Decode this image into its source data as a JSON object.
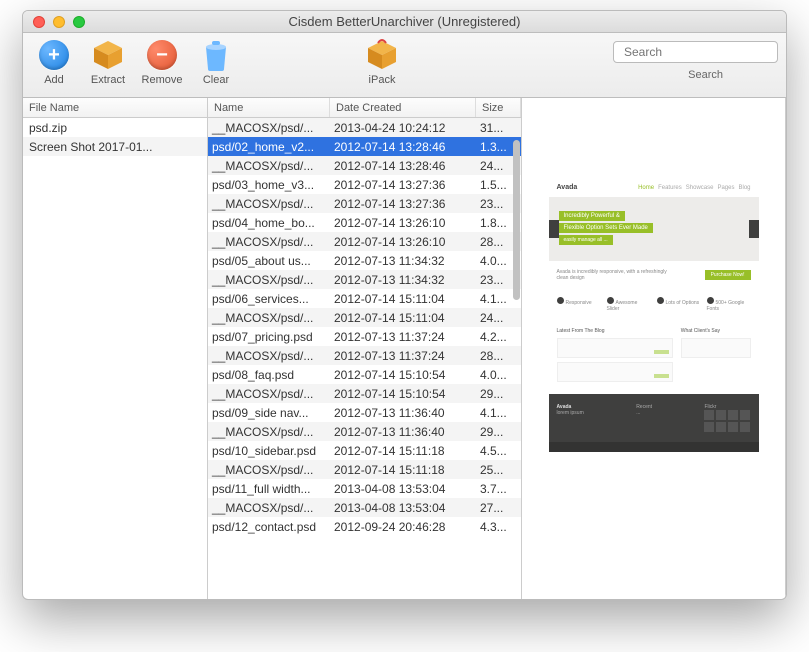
{
  "window": {
    "title": "Cisdem BetterUnarchiver (Unregistered)"
  },
  "toolbar": {
    "add": "Add",
    "extract": "Extract",
    "remove": "Remove",
    "clear": "Clear",
    "ipack": "iPack"
  },
  "search": {
    "placeholder": "Search",
    "label": "Search"
  },
  "files": {
    "header": "File Name",
    "items": [
      {
        "name": "psd.zip"
      },
      {
        "name": "Screen Shot 2017-01..."
      }
    ]
  },
  "entries": {
    "headers": {
      "name": "Name",
      "date": "Date Created",
      "size": "Size"
    },
    "rows": [
      {
        "name": "__MACOSX/psd/...",
        "date": "2013-04-24 10:24:12",
        "size": "31...",
        "selected": false
      },
      {
        "name": "psd/02_home_v2...",
        "date": "2012-07-14 13:28:46",
        "size": "1.3...",
        "selected": true
      },
      {
        "name": "__MACOSX/psd/...",
        "date": "2012-07-14 13:28:46",
        "size": "24...",
        "selected": false
      },
      {
        "name": "psd/03_home_v3...",
        "date": "2012-07-14 13:27:36",
        "size": "1.5...",
        "selected": false
      },
      {
        "name": "__MACOSX/psd/...",
        "date": "2012-07-14 13:27:36",
        "size": "23...",
        "selected": false
      },
      {
        "name": "psd/04_home_bo...",
        "date": "2012-07-14 13:26:10",
        "size": "1.8...",
        "selected": false
      },
      {
        "name": "__MACOSX/psd/...",
        "date": "2012-07-14 13:26:10",
        "size": "28...",
        "selected": false
      },
      {
        "name": "psd/05_about us...",
        "date": "2012-07-13 11:34:32",
        "size": "4.0...",
        "selected": false
      },
      {
        "name": "__MACOSX/psd/...",
        "date": "2012-07-13 11:34:32",
        "size": "23...",
        "selected": false
      },
      {
        "name": "psd/06_services...",
        "date": "2012-07-14 15:11:04",
        "size": "4.1...",
        "selected": false
      },
      {
        "name": "__MACOSX/psd/...",
        "date": "2012-07-14 15:11:04",
        "size": "24...",
        "selected": false
      },
      {
        "name": "psd/07_pricing.psd",
        "date": "2012-07-13 11:37:24",
        "size": "4.2...",
        "selected": false
      },
      {
        "name": "__MACOSX/psd/...",
        "date": "2012-07-13 11:37:24",
        "size": "28...",
        "selected": false
      },
      {
        "name": "psd/08_faq.psd",
        "date": "2012-07-14 15:10:54",
        "size": "4.0...",
        "selected": false
      },
      {
        "name": "__MACOSX/psd/...",
        "date": "2012-07-14 15:10:54",
        "size": "29...",
        "selected": false
      },
      {
        "name": "psd/09_side nav...",
        "date": "2012-07-13 11:36:40",
        "size": "4.1...",
        "selected": false
      },
      {
        "name": "__MACOSX/psd/...",
        "date": "2012-07-13 11:36:40",
        "size": "29...",
        "selected": false
      },
      {
        "name": "psd/10_sidebar.psd",
        "date": "2012-07-14 15:11:18",
        "size": "4.5...",
        "selected": false
      },
      {
        "name": "__MACOSX/psd/...",
        "date": "2012-07-14 15:11:18",
        "size": "25...",
        "selected": false
      },
      {
        "name": "psd/11_full width...",
        "date": "2013-04-08 13:53:04",
        "size": "3.7...",
        "selected": false
      },
      {
        "name": "__MACOSX/psd/...",
        "date": "2013-04-08 13:53:04",
        "size": "27...",
        "selected": false
      },
      {
        "name": "psd/12_contact.psd",
        "date": "2012-09-24 20:46:28",
        "size": "4.3...",
        "selected": false
      }
    ]
  }
}
